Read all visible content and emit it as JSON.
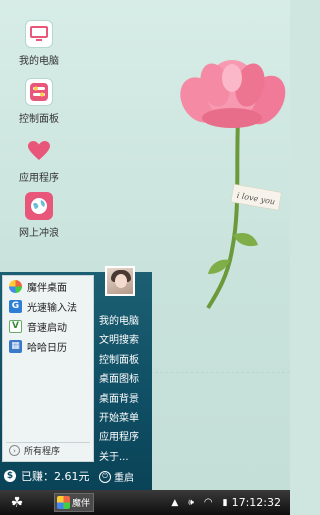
{
  "desktop": {
    "icons": [
      {
        "label": "我的电脑",
        "icon": "monitor-icon"
      },
      {
        "label": "控制面板",
        "icon": "control-panel-icon"
      },
      {
        "label": "应用程序",
        "icon": "heart-icon"
      },
      {
        "label": "网上冲浪",
        "icon": "globe-icon"
      }
    ],
    "wallpaper_tag": "i love you"
  },
  "start_menu": {
    "left_items": [
      {
        "label": "魔伴桌面",
        "icon": "pinwheel-icon"
      },
      {
        "label": "光速输入法",
        "icon": "input-method-icon"
      },
      {
        "label": "音速启动",
        "icon": "launcher-v-icon"
      },
      {
        "label": "哈哈日历",
        "icon": "calendar-icon"
      }
    ],
    "all_programs": "所有程序",
    "earned": "已赚：2.61元",
    "right_items": [
      "我的电脑",
      "文明搜索",
      "控制面板",
      "桌面图标",
      "桌面背景",
      "开始菜单",
      "应用程序",
      "关于..."
    ],
    "restart": "重启"
  },
  "taskbar": {
    "app_label": "魔伴",
    "clock": "17:12:32"
  },
  "colors": {
    "menu_bg": "#0f4e64",
    "taskbar_bg": "#0e0e0e",
    "accent_pink": "#e8577a"
  }
}
